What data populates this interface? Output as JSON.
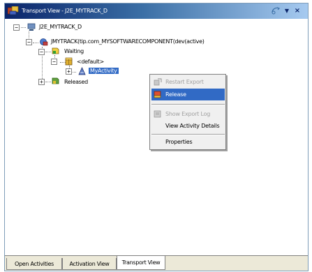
{
  "window": {
    "title": "Transport View - J2E_MYTRACK_D"
  },
  "tree": {
    "root_label": "J2E_MYTRACK_D",
    "component_label": "JMYTRACK(tip.com_MYSOFTWARECOMPONENT(dev(active)",
    "waiting_label": "Waiting",
    "default_label": "<default>",
    "activity_label": "MyActivity",
    "released_label": "Released"
  },
  "context_menu": {
    "items": [
      {
        "label": "Restart Export",
        "enabled": false,
        "icon": "restart-export-icon"
      },
      {
        "label": "Release",
        "enabled": true,
        "icon": "release-icon",
        "highlighted": true
      },
      {
        "label": "Show Export Log",
        "enabled": false,
        "icon": "export-log-icon"
      },
      {
        "label": "View Activity Details",
        "enabled": true
      },
      {
        "label": "Properties",
        "enabled": true
      }
    ]
  },
  "tabs": [
    {
      "label": "Open Activities"
    },
    {
      "label": "Activation View"
    },
    {
      "label": "Transport View",
      "active": true
    }
  ],
  "colors": {
    "selection": "#316ac5",
    "titlebar_start": "#0a246a",
    "titlebar_end": "#a6caf0"
  }
}
